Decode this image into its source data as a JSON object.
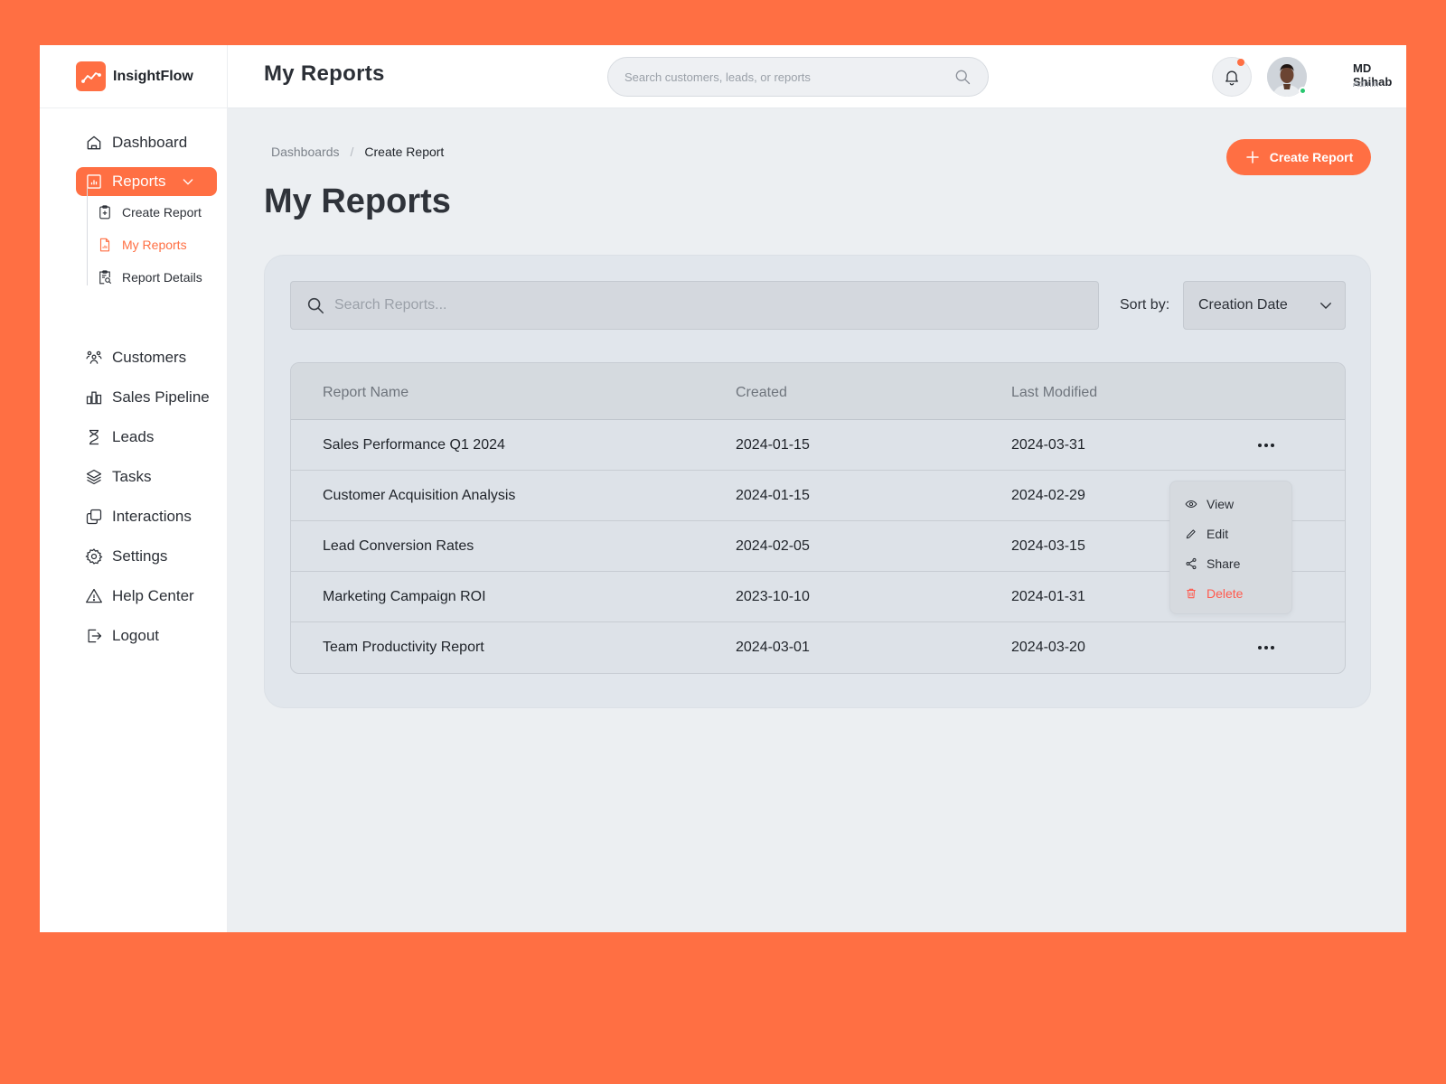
{
  "brand": {
    "name": "InsightFlow",
    "accent": "#FF6F43"
  },
  "header": {
    "title": "My Reports",
    "search_placeholder": "Search customers, leads, or reports",
    "user": {
      "name": "MD Shihab",
      "role": "Admin"
    }
  },
  "sidebar": {
    "items": [
      {
        "label": "Dashboard",
        "icon": "home-icon"
      },
      {
        "label": "Reports",
        "icon": "report-chart-icon",
        "active": true
      },
      {
        "label": "Customers",
        "icon": "users-icon"
      },
      {
        "label": "Sales Pipeline",
        "icon": "bar-chart-icon"
      },
      {
        "label": "Leads",
        "icon": "hourglass-icon"
      },
      {
        "label": "Tasks",
        "icon": "layers-icon"
      },
      {
        "label": "Interactions",
        "icon": "copy-icon"
      },
      {
        "label": "Settings",
        "icon": "gear-icon"
      },
      {
        "label": "Help Center",
        "icon": "warning-icon"
      },
      {
        "label": "Logout",
        "icon": "logout-icon"
      }
    ],
    "sub_items": [
      {
        "label": "Create Report",
        "icon": "clipboard-plus-icon"
      },
      {
        "label": "My Reports",
        "icon": "file-chart-icon",
        "current": true
      },
      {
        "label": "Report Details",
        "icon": "clipboard-search-icon"
      }
    ]
  },
  "breadcrumb": {
    "items": [
      "Dashboards",
      "Create Report"
    ],
    "separator": "/"
  },
  "page": {
    "title": "My Reports",
    "create_button": "Create Report"
  },
  "reports": {
    "search_placeholder": "Search Reports...",
    "sort_label": "Sort by:",
    "sort_value": "Creation Date",
    "columns": [
      "Report Name",
      "Created",
      "Last Modified"
    ],
    "rows": [
      {
        "name": "Sales Performance Q1 2024",
        "created": "2024-01-15",
        "modified": "2024-03-31"
      },
      {
        "name": "Customer Acquisition Analysis",
        "created": "2024-01-15",
        "modified": "2024-02-29"
      },
      {
        "name": "Lead Conversion Rates",
        "created": "2024-02-05",
        "modified": "2024-03-15"
      },
      {
        "name": "Marketing Campaign ROI",
        "created": "2023-10-10",
        "modified": "2024-01-31"
      },
      {
        "name": "Team Productivity Report",
        "created": "2024-03-01",
        "modified": "2024-03-20"
      }
    ]
  },
  "context_menu": {
    "items": [
      {
        "label": "View",
        "icon": "eye-icon"
      },
      {
        "label": "Edit",
        "icon": "pencil-icon"
      },
      {
        "label": "Share",
        "icon": "share-icon"
      },
      {
        "label": "Delete",
        "icon": "trash-icon",
        "color": "#FF5A4E"
      }
    ]
  }
}
